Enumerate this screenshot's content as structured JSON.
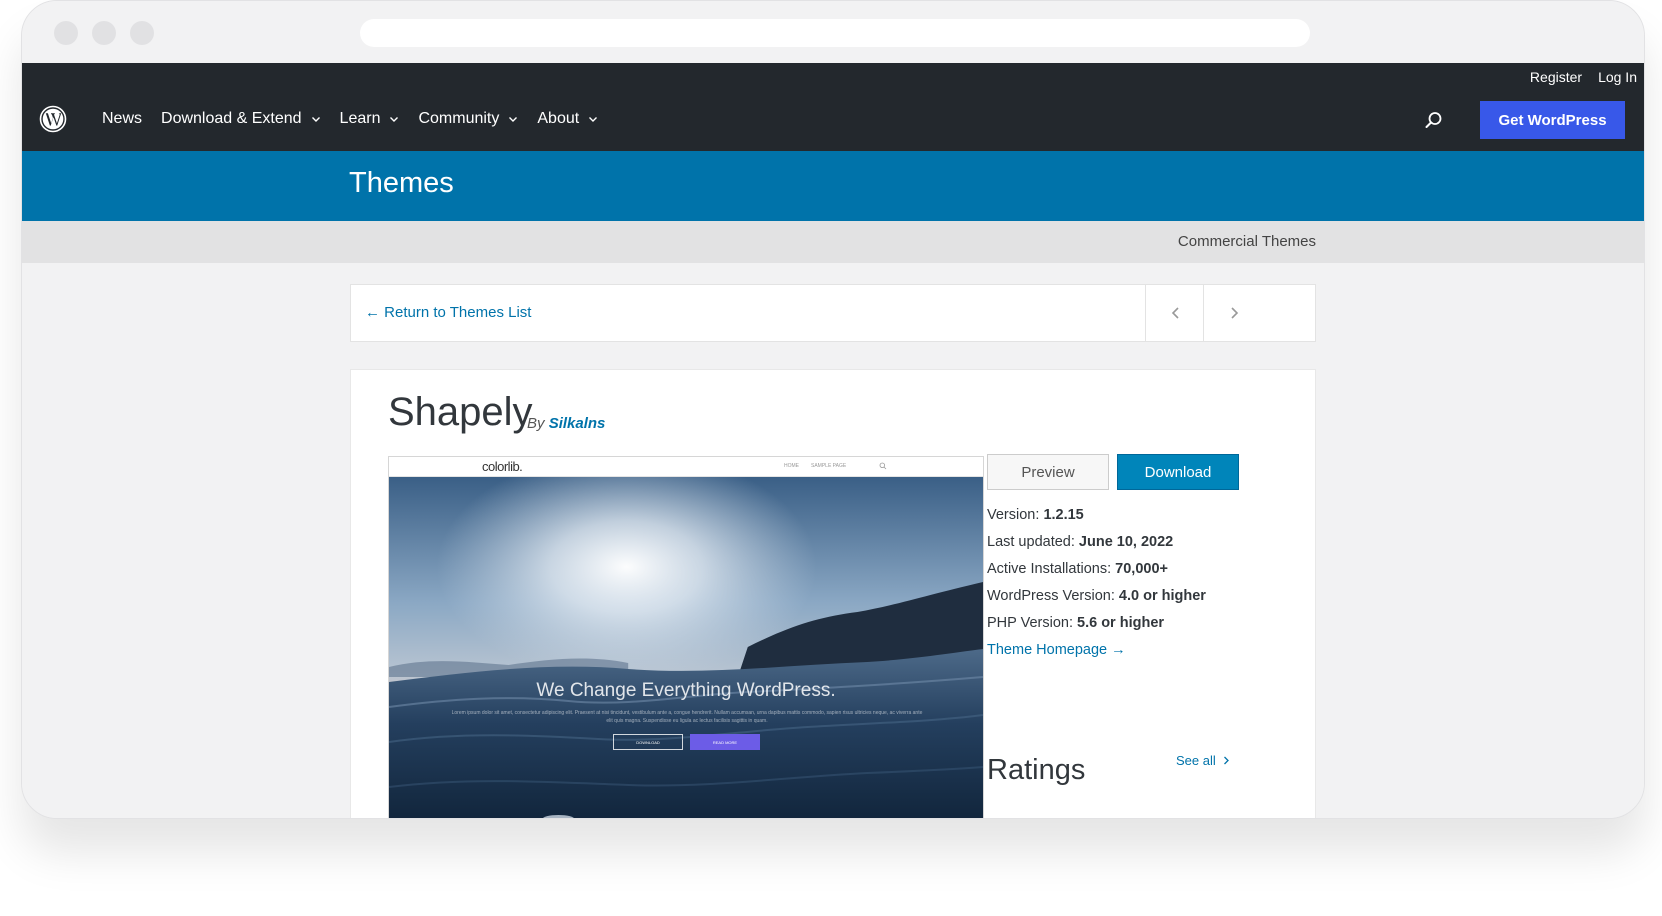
{
  "browser": {
    "url": ""
  },
  "header": {
    "top_links": [
      "Register",
      "Log In"
    ],
    "nav": [
      {
        "label": "News",
        "dropdown": false
      },
      {
        "label": "Download & Extend",
        "dropdown": true
      },
      {
        "label": "Learn",
        "dropdown": true
      },
      {
        "label": "Community",
        "dropdown": true
      },
      {
        "label": "About",
        "dropdown": true
      }
    ],
    "cta_label": "Get WordPress"
  },
  "banner": {
    "title": "Themes"
  },
  "subbar": {
    "commercial_label": "Commercial Themes"
  },
  "themes_nav": {
    "return_label": "← Return to Themes List"
  },
  "theme": {
    "name": "Shapely",
    "by_label": "By",
    "author": "Silkalns",
    "screenshot": {
      "logo": "colorlib.",
      "menu_items": [
        "HOME",
        "SAMPLE PAGE"
      ],
      "headline": "We Change Everything WordPress.",
      "body": "Lorem ipsum dolor sit amet, consectetur adipiscing elit. Praesent at nisi tincidunt, vestibulum ante a, congue hendrerit. Nullam accumsan, urna dapibus mattis commodo, sapien risus ultricies neque, ac viverra ante elit quis magna. Suspendisse eu ligula ac lectus facilisis sagittis in quam.",
      "button_a": "DOWNLOAD",
      "button_b": "READ MORE"
    },
    "preview_label": "Preview",
    "download_label": "Download",
    "meta": [
      {
        "label": "Version:",
        "value": "1.2.15"
      },
      {
        "label": "Last updated:",
        "value": "June 10, 2022"
      },
      {
        "label": "Active Installations:",
        "value": "70,000+"
      },
      {
        "label": "WordPress Version:",
        "value": "4.0 or higher"
      },
      {
        "label": "PHP Version:",
        "value": "5.6 or higher"
      }
    ],
    "homepage_label": "Theme Homepage →",
    "ratings_title": "Ratings",
    "see_all_label": "See all"
  },
  "colors": {
    "nav_bg": "#23282d",
    "themes_band": "#0073aa",
    "cta": "#3858e9",
    "link": "#0073aa",
    "download_btn": "#0085ba"
  },
  "icons": {
    "logo": "wordpress-logo-icon",
    "search": "search-icon",
    "prev": "chevron-left-icon",
    "next": "chevron-right-icon",
    "dropdown": "chevron-down-icon"
  }
}
